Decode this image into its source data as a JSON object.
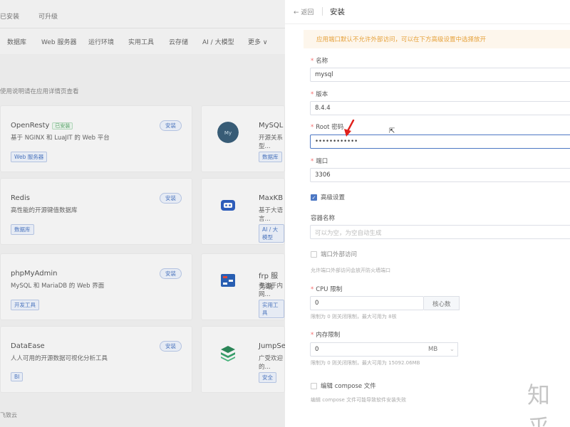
{
  "background": {
    "topbar": [
      "已安装",
      "可升级"
    ],
    "categories": [
      "数据库",
      "Web 服务器",
      "运行环境",
      "实用工具",
      "云存储",
      "AI / 大模型",
      "更多 ∨"
    ],
    "hint": "使用说明请在应用详情页查看",
    "footer": "飞致云",
    "cards": [
      {
        "name": "OpenResty",
        "badge": "已安装",
        "desc": "基于 NGINX 和 LuaJIT 的 Web 平台",
        "tag": "Web 服务器",
        "install": "安装"
      },
      {
        "name": "MySQL",
        "desc": "开源关系型...",
        "tag": "数据库",
        "logo_text": "MySQL"
      },
      {
        "name": "Redis",
        "desc": "高性能的开源键值数据库",
        "tag": "数据库",
        "install": "安装"
      },
      {
        "name": "MaxKB",
        "desc": "基于大语言...",
        "tag": "AI / 大模型"
      },
      {
        "name": "phpMyAdmin",
        "desc": "MySQL 和 MariaDB 的 Web 界面",
        "tag": "开发工具",
        "install": "安装"
      },
      {
        "name": "frp 服务端",
        "desc": "专注于内网...",
        "tag": "实用工具"
      },
      {
        "name": "DataEase",
        "desc": "人人可用的开源数据可视化分析工具",
        "tag": "BI",
        "install": "安装"
      },
      {
        "name": "JumpServer",
        "desc": "广受欢迎的...",
        "tag": "安全"
      }
    ]
  },
  "drawer": {
    "back": "返回",
    "title": "安装",
    "alert": "应用端口默认不允许外部访问，可以在下方高级设置中选择放开",
    "fields": {
      "name_label": "名称",
      "name_value": "mysql",
      "version_label": "版本",
      "version_value": "8.4.4",
      "root_label": "Root 密码",
      "root_value": "••••••••••••",
      "port_label": "端口",
      "port_value": "3306",
      "advanced_label": "高级设置",
      "container_label": "容器名称",
      "container_placeholder": "可以为空，为空自动生成",
      "external_label": "端口外部访问",
      "external_help": "允许端口外部访问会放开防火墙端口",
      "cpu_label": "CPU 限制",
      "cpu_value": "0",
      "cpu_unit": "核心数",
      "cpu_help": "限制为 0 则关闭限制，最大可用为 8核",
      "mem_label": "内存限制",
      "mem_value": "0",
      "mem_unit": "MB",
      "mem_help": "限制为 0 则关闭限制，最大可用为 15092.06MB",
      "compose_label": "编辑 compose 文件",
      "compose_help": "编辑 compose 文件可能导致软件安装失败"
    }
  },
  "watermark": "知乎",
  "colors": {
    "primary": "#4d78c4",
    "warning_bg": "#fdf6ec",
    "warning_text": "#e6a23c",
    "annotation": "#e0201b"
  }
}
